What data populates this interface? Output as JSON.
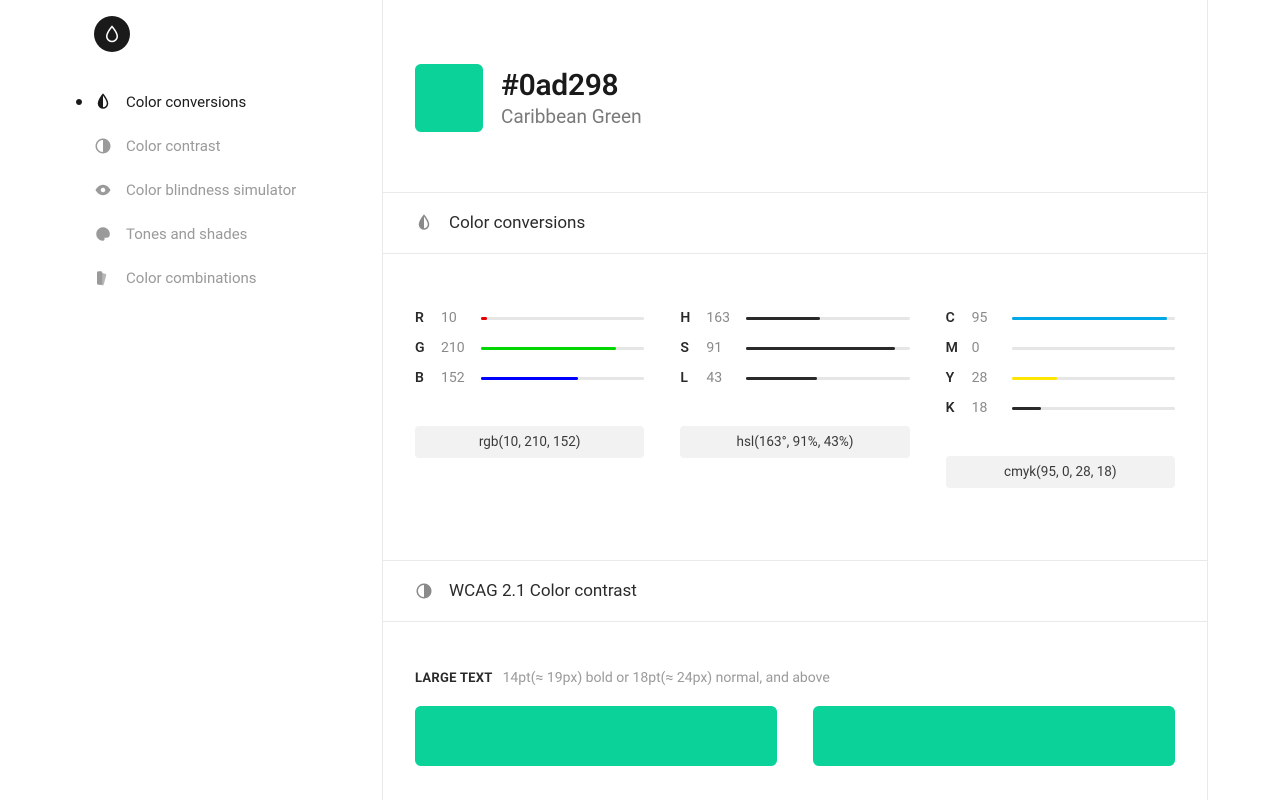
{
  "color": {
    "hex": "#0ad298",
    "name": "Caribbean Green"
  },
  "sidebar": {
    "items": [
      {
        "label": "Color conversions",
        "icon": "invert-icon",
        "active": true
      },
      {
        "label": "Color contrast",
        "icon": "contrast-icon",
        "active": false
      },
      {
        "label": "Color blindness simulator",
        "icon": "eye-icon",
        "active": false
      },
      {
        "label": "Tones and shades",
        "icon": "palette-icon",
        "active": false
      },
      {
        "label": "Color combinations",
        "icon": "swatches-icon",
        "active": false
      }
    ]
  },
  "sections": {
    "conversions_title": "Color conversions",
    "contrast_title": "WCAG 2.1 Color contrast"
  },
  "conversions": {
    "rgb": {
      "channels": [
        {
          "label": "R",
          "value": 10,
          "max": 255,
          "bar_color": "#e60000"
        },
        {
          "label": "G",
          "value": 210,
          "max": 255,
          "bar_color": "#00d600"
        },
        {
          "label": "B",
          "value": 152,
          "max": 255,
          "bar_color": "#0000ff"
        }
      ],
      "code": "rgb(10, 210, 152)"
    },
    "hsl": {
      "channels": [
        {
          "label": "H",
          "value": 163,
          "max": 360,
          "bar_color": "#2a2a2a"
        },
        {
          "label": "S",
          "value": 91,
          "max": 100,
          "bar_color": "#2a2a2a"
        },
        {
          "label": "L",
          "value": 43,
          "max": 100,
          "bar_color": "#2a2a2a"
        }
      ],
      "code": "hsl(163°, 91%, 43%)"
    },
    "cmyk": {
      "channels": [
        {
          "label": "C",
          "value": 95,
          "max": 100,
          "bar_color": "#00a8e8"
        },
        {
          "label": "M",
          "value": 0,
          "max": 100,
          "bar_color": "#e8007a"
        },
        {
          "label": "Y",
          "value": 28,
          "max": 100,
          "bar_color": "#ffe600"
        },
        {
          "label": "K",
          "value": 18,
          "max": 100,
          "bar_color": "#2a2a2a"
        }
      ],
      "code": "cmyk(95, 0, 28, 18)"
    }
  },
  "contrast": {
    "large_text_label": "LARGE TEXT",
    "large_text_desc": "14pt(≈ 19px) bold or 18pt(≈ 24px) normal, and above"
  }
}
